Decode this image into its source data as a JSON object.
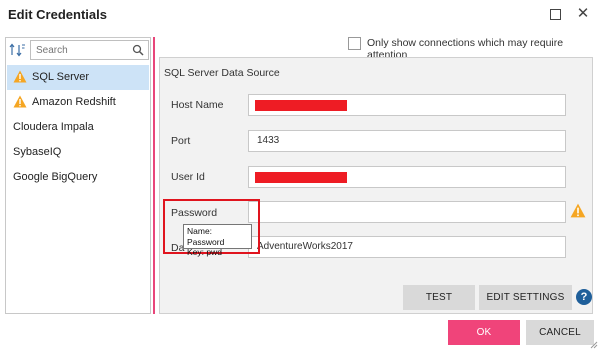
{
  "window": {
    "title": "Edit Credentials",
    "maximize_icon": "maximize-icon",
    "close_icon": "close-icon",
    "close_glyph": "✕"
  },
  "left_panel": {
    "sort_icon": "sort-icon",
    "sort_glyph": "↑↓",
    "search": {
      "placeholder": "Search",
      "value": "",
      "icon": "search-icon"
    },
    "connections": [
      {
        "label": "SQL Server",
        "warning": true,
        "selected": true
      },
      {
        "label": "Amazon Redshift",
        "warning": true,
        "selected": false
      },
      {
        "label": "Cloudera Impala",
        "warning": false,
        "selected": false
      },
      {
        "label": "SybaseIQ",
        "warning": false,
        "selected": false
      },
      {
        "label": "Google BigQuery",
        "warning": false,
        "selected": false
      }
    ]
  },
  "filter": {
    "only_attention_label": "Only show connections which may require attention",
    "checked": false
  },
  "data_source": {
    "title": "SQL Server Data Source",
    "fields": {
      "host_name": {
        "label": "Host Name",
        "value": "",
        "redacted": true
      },
      "port": {
        "label": "Port",
        "value": "1433"
      },
      "user_id": {
        "label": "User Id",
        "value": "",
        "redacted": true
      },
      "password": {
        "label": "Password",
        "value": "",
        "warning": true
      },
      "database": {
        "label": "Da",
        "value": "AdventureWorks2017"
      }
    },
    "tooltip": {
      "line1": "Name: Password",
      "line2": "Key: pwd"
    }
  },
  "actions": {
    "test_label": "TEST",
    "edit_settings_label": "EDIT SETTINGS",
    "help_glyph": "?",
    "ok_label": "OK",
    "cancel_label": "CANCEL"
  },
  "colors": {
    "accent": "#f0447a",
    "selection": "#cde3f7",
    "warning": "#f5a623",
    "redaction": "#ee1c24",
    "help": "#1f5f9a"
  }
}
